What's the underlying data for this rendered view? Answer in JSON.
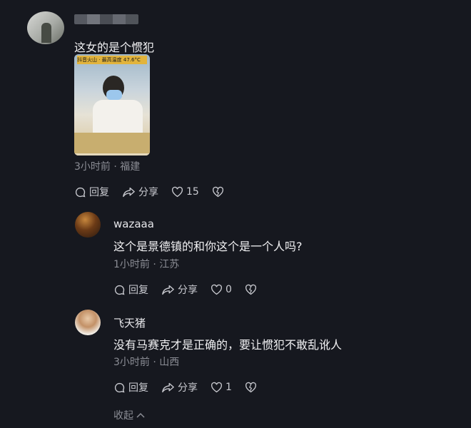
{
  "main_comment": {
    "text": "这女的是个惯犯",
    "meta": "3小时前 · 福建",
    "video_overlay": "抖音火山 · 最高温度 47.6°C",
    "actions": {
      "reply": "回复",
      "share": "分享",
      "likes": "15"
    }
  },
  "replies": [
    {
      "username": "wazaaa",
      "text": "这个是景德镇的和你这个是一个人吗?",
      "meta": "1小时前 · 江苏",
      "actions": {
        "reply": "回复",
        "share": "分享",
        "likes": "0"
      }
    },
    {
      "username": "飞天猪",
      "text": "没有马赛克才是正确的，要让惯犯不敢乱讹人",
      "meta": "3小时前 · 山西",
      "actions": {
        "reply": "回复",
        "share": "分享",
        "likes": "1"
      }
    }
  ],
  "collapse_label": "收起",
  "icons": [
    "reply-icon",
    "share-icon",
    "heart-icon",
    "dislike-icon",
    "chevron-up-icon"
  ],
  "colors": {
    "background": "#16181f",
    "meta_text": "#8b8d95",
    "primary_text": "#f0f0f2"
  }
}
